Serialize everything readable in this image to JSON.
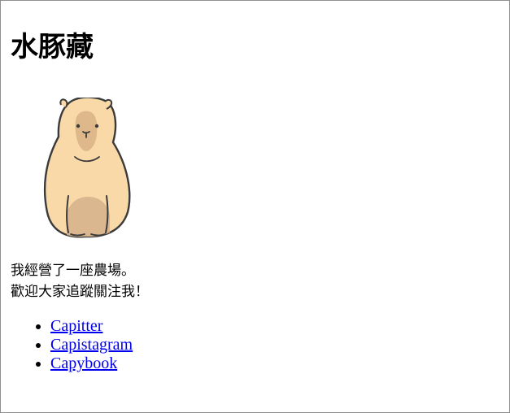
{
  "page": {
    "title": "水豚藏"
  },
  "avatar": {
    "icon": "capybara-icon",
    "alt": "",
    "colors": {
      "body": "#f9d9a8",
      "shadow": "#d7b38d",
      "outline": "#3b3b3b",
      "face": "#d9b185"
    }
  },
  "intro": {
    "lines": [
      "我經營了一座農場。",
      "歡迎大家追蹤關注我！"
    ]
  },
  "social_links": {
    "items": [
      {
        "label": "Capitter"
      },
      {
        "label": "Capistagram"
      },
      {
        "label": "Capybook"
      }
    ],
    "link_color": "#0000ee"
  }
}
